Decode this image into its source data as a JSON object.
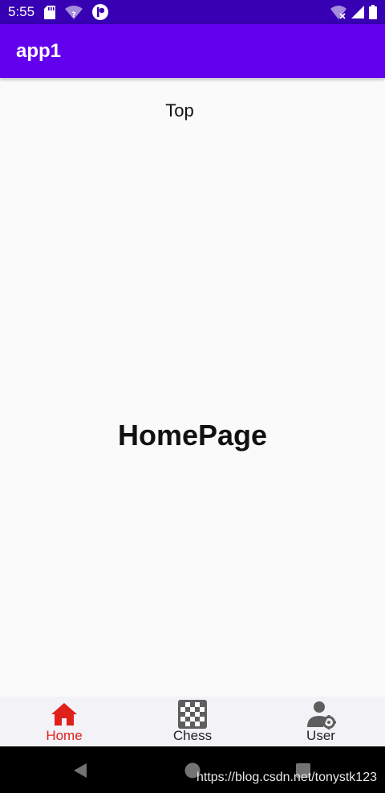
{
  "status_bar": {
    "time": "5:55",
    "left_icons": [
      "sd-card-icon",
      "wifi-question-icon",
      "notification-p-icon"
    ],
    "right_icons": [
      "wifi-off-icon",
      "signal-icon",
      "battery-icon"
    ]
  },
  "app_bar": {
    "title": "app1",
    "color": "#6200ee"
  },
  "content": {
    "top_label": "Top",
    "page_title": "HomePage"
  },
  "bottom_nav": {
    "active_color": "#e0201b",
    "items": [
      {
        "label": "Home",
        "icon": "home-icon",
        "active": true
      },
      {
        "label": "Chess",
        "icon": "chessboard-icon",
        "active": false
      },
      {
        "label": "User",
        "icon": "user-settings-icon",
        "active": false
      }
    ]
  },
  "system_nav": {
    "buttons": [
      "back-icon",
      "home-circle-icon",
      "recents-icon"
    ],
    "watermark": "https://blog.csdn.net/tonystk123"
  }
}
